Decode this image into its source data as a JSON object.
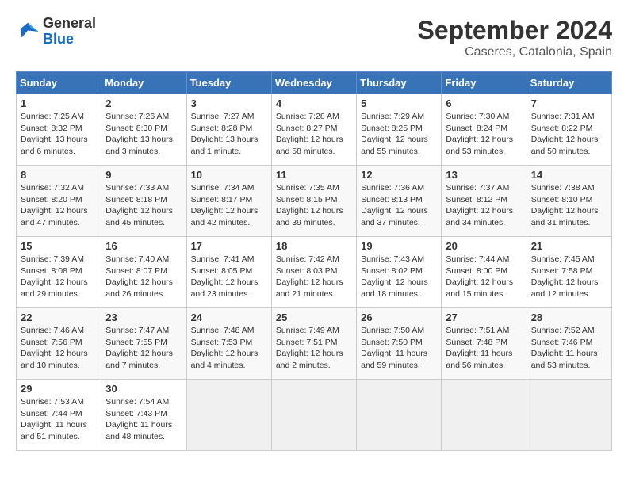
{
  "header": {
    "logo_general": "General",
    "logo_blue": "Blue",
    "month_title": "September 2024",
    "location": "Caseres, Catalonia, Spain"
  },
  "days_of_week": [
    "Sunday",
    "Monday",
    "Tuesday",
    "Wednesday",
    "Thursday",
    "Friday",
    "Saturday"
  ],
  "weeks": [
    [
      {
        "day": 1,
        "sunrise": "Sunrise: 7:25 AM",
        "sunset": "Sunset: 8:32 PM",
        "daylight": "Daylight: 13 hours and 6 minutes."
      },
      {
        "day": 2,
        "sunrise": "Sunrise: 7:26 AM",
        "sunset": "Sunset: 8:30 PM",
        "daylight": "Daylight: 13 hours and 3 minutes."
      },
      {
        "day": 3,
        "sunrise": "Sunrise: 7:27 AM",
        "sunset": "Sunset: 8:28 PM",
        "daylight": "Daylight: 13 hours and 1 minute."
      },
      {
        "day": 4,
        "sunrise": "Sunrise: 7:28 AM",
        "sunset": "Sunset: 8:27 PM",
        "daylight": "Daylight: 12 hours and 58 minutes."
      },
      {
        "day": 5,
        "sunrise": "Sunrise: 7:29 AM",
        "sunset": "Sunset: 8:25 PM",
        "daylight": "Daylight: 12 hours and 55 minutes."
      },
      {
        "day": 6,
        "sunrise": "Sunrise: 7:30 AM",
        "sunset": "Sunset: 8:24 PM",
        "daylight": "Daylight: 12 hours and 53 minutes."
      },
      {
        "day": 7,
        "sunrise": "Sunrise: 7:31 AM",
        "sunset": "Sunset: 8:22 PM",
        "daylight": "Daylight: 12 hours and 50 minutes."
      }
    ],
    [
      {
        "day": 8,
        "sunrise": "Sunrise: 7:32 AM",
        "sunset": "Sunset: 8:20 PM",
        "daylight": "Daylight: 12 hours and 47 minutes."
      },
      {
        "day": 9,
        "sunrise": "Sunrise: 7:33 AM",
        "sunset": "Sunset: 8:18 PM",
        "daylight": "Daylight: 12 hours and 45 minutes."
      },
      {
        "day": 10,
        "sunrise": "Sunrise: 7:34 AM",
        "sunset": "Sunset: 8:17 PM",
        "daylight": "Daylight: 12 hours and 42 minutes."
      },
      {
        "day": 11,
        "sunrise": "Sunrise: 7:35 AM",
        "sunset": "Sunset: 8:15 PM",
        "daylight": "Daylight: 12 hours and 39 minutes."
      },
      {
        "day": 12,
        "sunrise": "Sunrise: 7:36 AM",
        "sunset": "Sunset: 8:13 PM",
        "daylight": "Daylight: 12 hours and 37 minutes."
      },
      {
        "day": 13,
        "sunrise": "Sunrise: 7:37 AM",
        "sunset": "Sunset: 8:12 PM",
        "daylight": "Daylight: 12 hours and 34 minutes."
      },
      {
        "day": 14,
        "sunrise": "Sunrise: 7:38 AM",
        "sunset": "Sunset: 8:10 PM",
        "daylight": "Daylight: 12 hours and 31 minutes."
      }
    ],
    [
      {
        "day": 15,
        "sunrise": "Sunrise: 7:39 AM",
        "sunset": "Sunset: 8:08 PM",
        "daylight": "Daylight: 12 hours and 29 minutes."
      },
      {
        "day": 16,
        "sunrise": "Sunrise: 7:40 AM",
        "sunset": "Sunset: 8:07 PM",
        "daylight": "Daylight: 12 hours and 26 minutes."
      },
      {
        "day": 17,
        "sunrise": "Sunrise: 7:41 AM",
        "sunset": "Sunset: 8:05 PM",
        "daylight": "Daylight: 12 hours and 23 minutes."
      },
      {
        "day": 18,
        "sunrise": "Sunrise: 7:42 AM",
        "sunset": "Sunset: 8:03 PM",
        "daylight": "Daylight: 12 hours and 21 minutes."
      },
      {
        "day": 19,
        "sunrise": "Sunrise: 7:43 AM",
        "sunset": "Sunset: 8:02 PM",
        "daylight": "Daylight: 12 hours and 18 minutes."
      },
      {
        "day": 20,
        "sunrise": "Sunrise: 7:44 AM",
        "sunset": "Sunset: 8:00 PM",
        "daylight": "Daylight: 12 hours and 15 minutes."
      },
      {
        "day": 21,
        "sunrise": "Sunrise: 7:45 AM",
        "sunset": "Sunset: 7:58 PM",
        "daylight": "Daylight: 12 hours and 12 minutes."
      }
    ],
    [
      {
        "day": 22,
        "sunrise": "Sunrise: 7:46 AM",
        "sunset": "Sunset: 7:56 PM",
        "daylight": "Daylight: 12 hours and 10 minutes."
      },
      {
        "day": 23,
        "sunrise": "Sunrise: 7:47 AM",
        "sunset": "Sunset: 7:55 PM",
        "daylight": "Daylight: 12 hours and 7 minutes."
      },
      {
        "day": 24,
        "sunrise": "Sunrise: 7:48 AM",
        "sunset": "Sunset: 7:53 PM",
        "daylight": "Daylight: 12 hours and 4 minutes."
      },
      {
        "day": 25,
        "sunrise": "Sunrise: 7:49 AM",
        "sunset": "Sunset: 7:51 PM",
        "daylight": "Daylight: 12 hours and 2 minutes."
      },
      {
        "day": 26,
        "sunrise": "Sunrise: 7:50 AM",
        "sunset": "Sunset: 7:50 PM",
        "daylight": "Daylight: 11 hours and 59 minutes."
      },
      {
        "day": 27,
        "sunrise": "Sunrise: 7:51 AM",
        "sunset": "Sunset: 7:48 PM",
        "daylight": "Daylight: 11 hours and 56 minutes."
      },
      {
        "day": 28,
        "sunrise": "Sunrise: 7:52 AM",
        "sunset": "Sunset: 7:46 PM",
        "daylight": "Daylight: 11 hours and 53 minutes."
      }
    ],
    [
      {
        "day": 29,
        "sunrise": "Sunrise: 7:53 AM",
        "sunset": "Sunset: 7:44 PM",
        "daylight": "Daylight: 11 hours and 51 minutes."
      },
      {
        "day": 30,
        "sunrise": "Sunrise: 7:54 AM",
        "sunset": "Sunset: 7:43 PM",
        "daylight": "Daylight: 11 hours and 48 minutes."
      },
      null,
      null,
      null,
      null,
      null
    ]
  ]
}
